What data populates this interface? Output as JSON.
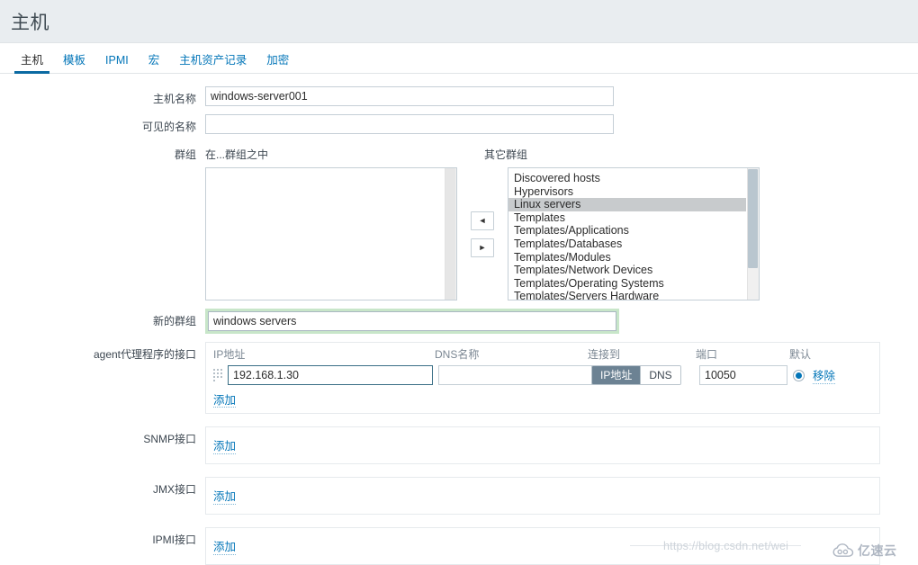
{
  "header": {
    "title": "主机"
  },
  "tabs": [
    {
      "label": "主机",
      "active": true
    },
    {
      "label": "模板",
      "active": false
    },
    {
      "label": "IPMI",
      "active": false
    },
    {
      "label": "宏",
      "active": false
    },
    {
      "label": "主机资产记录",
      "active": false
    },
    {
      "label": "加密",
      "active": false
    }
  ],
  "form": {
    "host_name": {
      "label": "主机名称",
      "value": "windows-server001",
      "placeholder": ""
    },
    "visible_name": {
      "label": "可见的名称",
      "value": "",
      "placeholder": ""
    },
    "groups": {
      "label": "群组",
      "in_groups_label": "在...群组之中",
      "other_groups_label": "其它群组",
      "in_groups": [],
      "other_groups": [
        "Discovered hosts",
        "Hypervisors",
        "Linux servers",
        "Templates",
        "Templates/Applications",
        "Templates/Databases",
        "Templates/Modules",
        "Templates/Network Devices",
        "Templates/Operating Systems",
        "Templates/Servers Hardware"
      ],
      "selected_other": "Linux servers",
      "move_left_icon": "arrow-left-icon",
      "move_right_icon": "arrow-right-icon",
      "move_left_glyph": "◄",
      "move_right_glyph": "►"
    },
    "new_group": {
      "label": "新的群组",
      "value": "windows servers",
      "placeholder": ""
    },
    "agent_interface": {
      "label": "agent代理程序的接口",
      "columns": {
        "ip": "IP地址",
        "dns": "DNS名称",
        "connect_to": "连接到",
        "port": "端口",
        "default": "默认"
      },
      "rows": [
        {
          "ip": "192.168.1.30",
          "dns": "",
          "connect_to_options": [
            "IP地址",
            "DNS"
          ],
          "connect_to_selected": "IP地址",
          "port": "10050",
          "is_default": true,
          "remove_label": "移除"
        }
      ],
      "add_label": "添加"
    },
    "snmp_interface": {
      "label": "SNMP接口",
      "add_label": "添加"
    },
    "jmx_interface": {
      "label": "JMX接口",
      "add_label": "添加"
    },
    "ipmi_interface": {
      "label": "IPMI接口",
      "add_label": "添加"
    }
  },
  "watermarks": {
    "url": "https://blog.csdn.net/wei",
    "logo_text": "亿速云",
    "logo_icon": "cloud-icon"
  },
  "colors": {
    "accent": "#0275b8",
    "tab_active_underline": "#0b6aa2",
    "header_bg": "#e9edf0",
    "highlight_green": "#c8e6c9",
    "toggle_on_bg": "#6c8293",
    "list_selected_bg": "#c8cbcd"
  }
}
